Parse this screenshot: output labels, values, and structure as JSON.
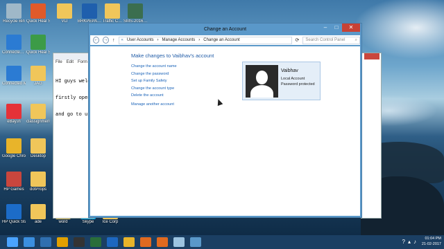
{
  "desktop": {
    "icons": [
      {
        "label": "Recycle Bin",
        "color": "#9fb8c8"
      },
      {
        "label": "Quick Heal Self Backup",
        "color": "#e05a2a"
      },
      {
        "label": "VLI",
        "color": "#f0c65a"
      },
      {
        "label": "Connecte… Mobile Networ…",
        "color": "#2b7bd3"
      },
      {
        "label": "Quick Heal Screen Blo…",
        "color": "#3c9b47"
      },
      {
        "label": "Connected Music powe…",
        "color": "#2b7bd3"
      },
      {
        "label": "JAG",
        "color": "#f0c65a"
      },
      {
        "label": "eBay.in",
        "color": "#e53238"
      },
      {
        "label": "classignment",
        "color": "#f0c65a"
      },
      {
        "label": "Google Chrome",
        "color": "#e8b42a"
      },
      {
        "label": "Desktop",
        "color": "#f0c65a"
      },
      {
        "label": "HP Games",
        "color": "#c9463d"
      },
      {
        "label": "dotProps",
        "color": "#f0c65a"
      },
      {
        "label": "HP Quick Start",
        "color": "#1c6cc8"
      },
      {
        "label": "ade",
        "color": "#f0c65a"
      },
      {
        "label": "word",
        "color": "#f0c65a"
      },
      {
        "label": "Skype",
        "color": "#00aff0"
      },
      {
        "label": "Ice Corp",
        "color": "#f0c65a"
      },
      {
        "label": "BRKPEPA…",
        "color": "#1f5fad"
      },
      {
        "label": "Traffic C…",
        "color": "#f0c65a"
      },
      {
        "label": "SMS-2016…",
        "color": "#3b6e4f"
      }
    ]
  },
  "notepad": {
    "menu": [
      "File",
      "Edit",
      "Form"
    ],
    "lines": [
      "HI guys welc",
      "firstly open",
      "and go to us"
    ]
  },
  "window": {
    "title": "Change an Account",
    "minimize": "–",
    "maximize": "□",
    "close": "✕",
    "breadcrumb": [
      "User Accounts",
      "Manage Accounts",
      "Change an Account"
    ],
    "search_placeholder": "Search Control Panel",
    "heading": "Make changes to Vaibhav's account",
    "links": [
      "Change the account name",
      "Change the password",
      "Set up Family Safety",
      "Change the account type",
      "Delete the account",
      "Manage another account"
    ],
    "account": {
      "name": "Vaibhav",
      "type": "Local Account",
      "status": "Password protected"
    }
  },
  "taskbar": {
    "time": "01:04 PM",
    "date": "21-02-2017",
    "apps": [
      {
        "name": "start",
        "color": "#4aa3ff"
      },
      {
        "name": "ie",
        "color": "#3b8fe0"
      },
      {
        "name": "app2",
        "color": "#2f6fb0"
      },
      {
        "name": "app3",
        "color": "#e0a000"
      },
      {
        "name": "app4",
        "color": "#333"
      },
      {
        "name": "app5",
        "color": "#2a6e3a"
      },
      {
        "name": "hp",
        "color": "#1d67c0"
      },
      {
        "name": "chrome",
        "color": "#e8b42a"
      },
      {
        "name": "app8",
        "color": "#e06a20"
      },
      {
        "name": "app9",
        "color": "#e06a20"
      },
      {
        "name": "notepad",
        "color": "#9cc3e0"
      },
      {
        "name": "controlpanel",
        "color": "#5a98c9"
      }
    ]
  }
}
